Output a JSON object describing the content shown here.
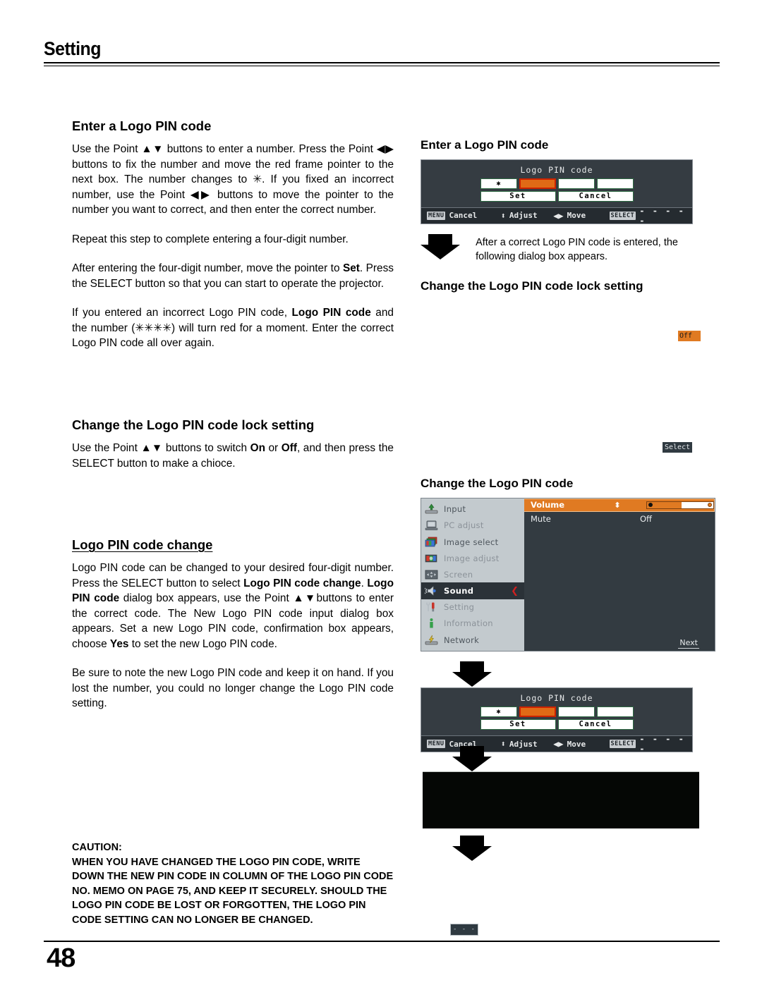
{
  "header": {
    "chapter_title": "Setting"
  },
  "footer": {
    "page_number": "48"
  },
  "left_column": {
    "sections": [
      {
        "heading": "Enter a Logo PIN code",
        "underlined": false,
        "paragraphs": [
          "Use the Point ▲▼ buttons to enter a number. Press the Point ◀▶ buttons to fix the number and move the red frame pointer to the next box. The number changes to ✳. If you fixed an incorrect number, use the Point ◀▶ buttons to move the pointer to the number you want to correct, and then enter the correct number.",
          "Repeat this step to complete entering a four-digit number.",
          "After entering the four-digit number, move the pointer to Set. Press the SELECT button so that you can start to operate the projector.",
          "If you entered an incorrect Logo PIN code, Logo PIN code and the number (✳✳✳✳) will turn red for a moment. Enter the correct Logo PIN code all over again."
        ]
      },
      {
        "heading": "Change the Logo PIN code lock setting",
        "underlined": false,
        "paragraphs": [
          "Use the Point ▲▼ buttons to switch On or Off, and then press the SELECT button to make a chioce."
        ]
      },
      {
        "heading": "Logo PIN code change",
        "underlined": true,
        "paragraphs": [
          "Logo PIN code can be changed to your desired four-digit number. Press the SELECT button to select Logo PIN code change. Logo PIN code dialog box appears, use the Point ▲▼buttons to enter the correct code. The New Logo PIN code input dialog box appears. Set a new Logo PIN code, confirmation box appears, choose Yes to set the new Logo PIN code.",
          "Be sure to note the new Logo PIN code and keep it on hand. If you lost the number, you could no longer change the Logo PIN code setting."
        ]
      }
    ]
  },
  "caution": {
    "title": "CAUTION:",
    "body": "WHEN YOU HAVE CHANGED THE LOGO PIN CODE, WRITE DOWN THE NEW PIN CODE IN COLUMN OF THE LOGO PIN CODE NO. MEMO ON PAGE 75, AND KEEP IT SECURELY. SHOULD THE LOGO PIN CODE BE LOST OR FORGOTTEN, THE LOGO PIN CODE SETTING CAN NO LONGER BE CHANGED."
  },
  "right_column": {
    "fig1_heading": "Enter a Logo PIN code",
    "fig2_heading": "Change the Logo PIN code lock setting",
    "fig3_heading": "Change the Logo PIN code",
    "arrow_note": "After a correct Logo PIN code is entered, the following dialog box appears.",
    "badge_off": "Off",
    "badge_select": "Select",
    "badge_dashes": "- - - -"
  },
  "pin_dialog": {
    "title": "Logo PIN code",
    "digits": [
      "✱",
      "",
      "",
      ""
    ],
    "set_label": "Set",
    "cancel_label": "Cancel",
    "hints": {
      "menu_key": "MENU",
      "menu_action": "Cancel",
      "adjust_glyph": "⬍",
      "adjust_action": "Adjust",
      "move_glyph": "◀▶",
      "move_action": "Move",
      "select_key": "SELECT",
      "select_action": "- - - - -"
    }
  },
  "osd_menu": {
    "sidebar": [
      {
        "label": "Input",
        "icon": "input-icon",
        "state": "enabled"
      },
      {
        "label": "PC adjust",
        "icon": "pc-adjust-icon",
        "state": "disabled"
      },
      {
        "label": "Image select",
        "icon": "image-select-icon",
        "state": "enabled"
      },
      {
        "label": "Image adjust",
        "icon": "image-adjust-icon",
        "state": "disabled"
      },
      {
        "label": "Screen",
        "icon": "screen-icon",
        "state": "disabled"
      },
      {
        "label": "Sound",
        "icon": "sound-icon",
        "state": "selected"
      },
      {
        "label": "Setting",
        "icon": "setting-icon",
        "state": "disabled"
      },
      {
        "label": "Information",
        "icon": "information-icon",
        "state": "disabled"
      },
      {
        "label": "Network",
        "icon": "network-icon",
        "state": "enabled"
      }
    ],
    "rows": [
      {
        "label": "Volume",
        "value": "",
        "highlighted": true
      },
      {
        "label": "Mute",
        "value": "Off",
        "highlighted": false
      }
    ],
    "volume_percent": 52,
    "next_label": "Next"
  },
  "colors": {
    "accent_orange": "#e07a22",
    "osd_panel": "#333b41",
    "osd_sidebar": "#c3cace",
    "selected_row": "#2b3238",
    "red_frame": "#cc2200"
  }
}
